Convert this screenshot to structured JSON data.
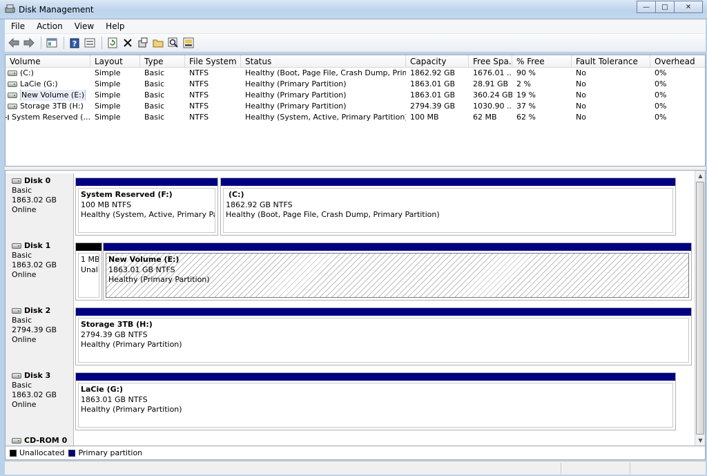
{
  "window": {
    "title": "Disk Management",
    "minimize_glyph": "—",
    "maximize_glyph": "□",
    "close_glyph": "✕"
  },
  "menu": [
    "File",
    "Action",
    "View",
    "Help"
  ],
  "toolbar": [
    "back-arrow-icon",
    "forward-arrow-icon",
    "list-view-icon",
    "help-icon",
    "properties-icon",
    "refresh-icon",
    "delete-icon",
    "settings-icon",
    "open-folder-icon",
    "search-icon",
    "export-icon"
  ],
  "volume_list": {
    "columns": [
      "Volume",
      "Layout",
      "Type",
      "File System",
      "Status",
      "Capacity",
      "Free Spa...",
      "% Free",
      "Fault Tolerance",
      "Overhead"
    ],
    "rows": [
      [
        "(C:)",
        "Simple",
        "Basic",
        "NTFS",
        "Healthy (Boot, Page File, Crash Dump, Prim...",
        "1862.92 GB",
        "1676.01 ...",
        "90 %",
        "No",
        "0%"
      ],
      [
        "LaCie (G:)",
        "Simple",
        "Basic",
        "NTFS",
        "Healthy (Primary Partition)",
        "1863.01 GB",
        "28.91 GB",
        "2 %",
        "No",
        "0%"
      ],
      [
        "New Volume (E:)",
        "Simple",
        "Basic",
        "NTFS",
        "Healthy (Primary Partition)",
        "1863.01 GB",
        "360.24 GB",
        "19 %",
        "No",
        "0%"
      ],
      [
        "Storage 3TB (H:)",
        "Simple",
        "Basic",
        "NTFS",
        "Healthy (Primary Partition)",
        "2794.39 GB",
        "1030.90 ...",
        "37 %",
        "No",
        "0%"
      ],
      [
        "System Reserved (...",
        "Simple",
        "Basic",
        "NTFS",
        "Healthy (System, Active, Primary Partition)",
        "100 MB",
        "62 MB",
        "62 %",
        "No",
        "0%"
      ]
    ]
  },
  "disks": [
    {
      "name": "Disk 0",
      "type": "Basic",
      "size": "1863.02 GB",
      "status": "Online",
      "partitions": [
        {
          "title": "System Reserved  (F:)",
          "size": "100 MB NTFS",
          "status": "Healthy (System, Active, Primary Partiti"
        },
        {
          "title": "(C:)",
          "size": "1862.92 GB NTFS",
          "status": "Healthy (Boot, Page File, Crash Dump, Primary Partition)"
        }
      ]
    },
    {
      "name": "Disk 1",
      "type": "Basic",
      "size": "1863.02 GB",
      "status": "Online",
      "partitions": [
        {
          "title": "1 MB",
          "size": "Unall",
          "status": ""
        },
        {
          "title": "New Volume  (E:)",
          "size": "1863.01 GB NTFS",
          "status": "Healthy (Primary Partition)"
        }
      ]
    },
    {
      "name": "Disk 2",
      "type": "Basic",
      "size": "2794.39 GB",
      "status": "Online",
      "partitions": [
        {
          "title": "Storage 3TB  (H:)",
          "size": "2794.39 GB NTFS",
          "status": "Healthy (Primary Partition)"
        }
      ]
    },
    {
      "name": "Disk 3",
      "type": "Basic",
      "size": "1863.02 GB",
      "status": "Online",
      "partitions": [
        {
          "title": "LaCie  (G:)",
          "size": "1863.01 GB NTFS",
          "status": "Healthy (Primary Partition)"
        }
      ]
    },
    {
      "name": "CD-ROM 0"
    }
  ],
  "legend": [
    {
      "label": "Unallocated",
      "color": "#000000"
    },
    {
      "label": "Primary partition",
      "color": "#000080"
    }
  ],
  "colors": {
    "primary": "#000080",
    "unallocated": "#000000"
  }
}
